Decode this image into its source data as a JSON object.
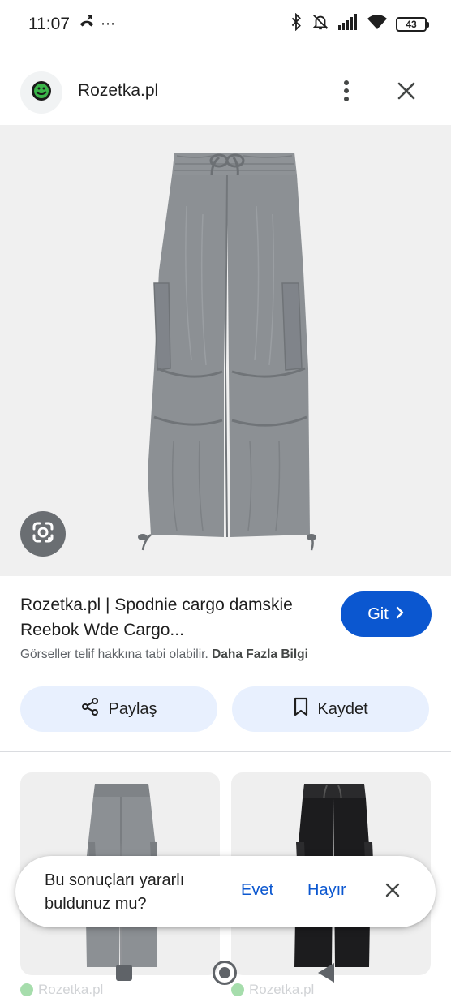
{
  "status_bar": {
    "time": "11:07",
    "battery_level": "43",
    "icons": [
      "call-forward-icon",
      "more-dots-icon",
      "bluetooth-icon",
      "notifications-off-icon",
      "signal-icon",
      "wifi-icon",
      "battery-icon"
    ]
  },
  "header": {
    "site_name": "Rozetka.pl",
    "site_icon": "rozetka-logo-icon",
    "more_icon": "more-vert-icon",
    "close_icon": "close-icon"
  },
  "result": {
    "title": "Rozetka.pl | Spodnie cargo damskie Reebok Wde Cargo...",
    "go_label": "Git",
    "copyright_text": "Görseller telif hakkına tabi olabilir.",
    "more_info_label": "Daha Fazla Bilgi",
    "share_label": "Paylaş",
    "save_label": "Kaydet"
  },
  "related": [
    {
      "source": "Rozetka.pl",
      "color": "#8c9094"
    },
    {
      "source": "Rozetka.pl",
      "color": "#1c1c1e"
    }
  ],
  "feedback": {
    "question": "Bu sonuçları yararlı buldunuz mu?",
    "yes_label": "Evet",
    "no_label": "Hayır"
  },
  "colors": {
    "accent": "#0b57d0",
    "chip_bg": "#e8f0fe",
    "pants_gray": "#8c9094",
    "pants_black": "#1c1c1e"
  }
}
